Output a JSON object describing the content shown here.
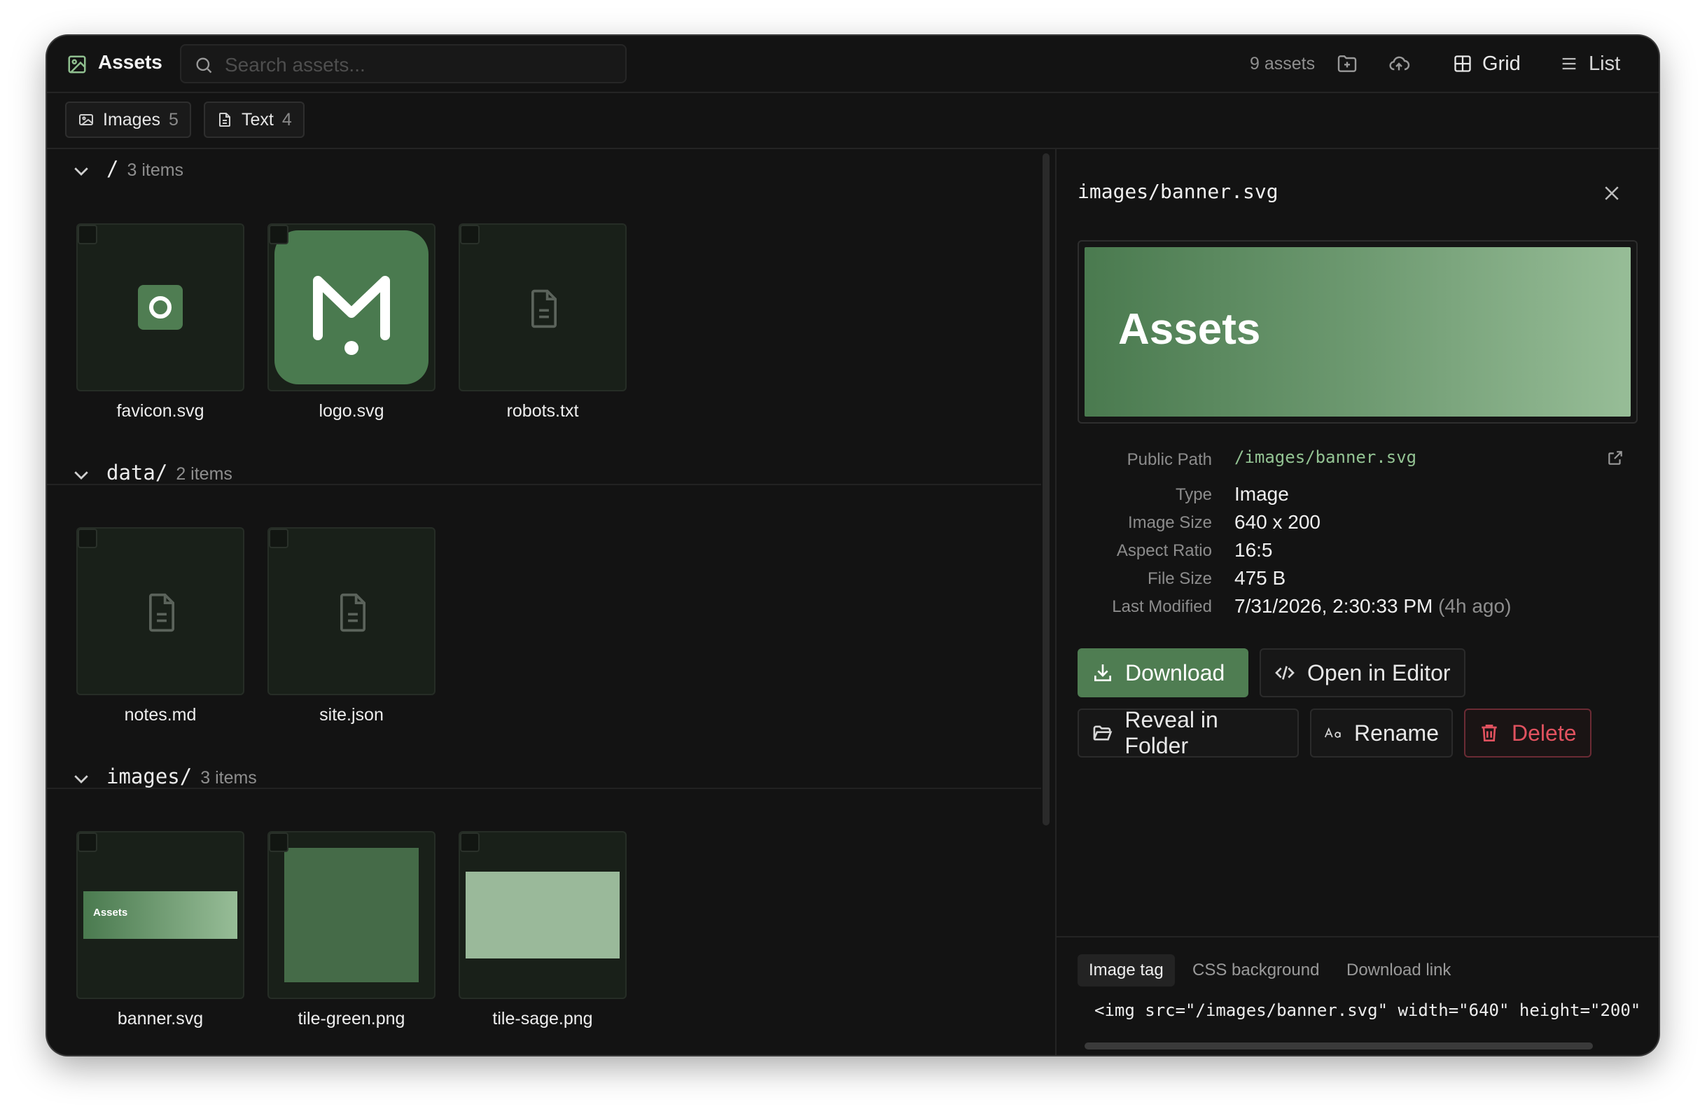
{
  "app": {
    "title": "Assets",
    "asset_count": "9 assets"
  },
  "search": {
    "placeholder": "Search assets..."
  },
  "view": {
    "grid_label": "Grid",
    "list_label": "List",
    "active": "grid"
  },
  "filters": [
    {
      "label": "Images",
      "count": "5"
    },
    {
      "label": "Text",
      "count": "4"
    }
  ],
  "sections": [
    {
      "name": "/",
      "count": "3 items",
      "files": [
        {
          "name": "favicon.svg",
          "preview": "favicon"
        },
        {
          "name": "logo.svg",
          "preview": "logo"
        },
        {
          "name": "robots.txt",
          "preview": "file-icon"
        }
      ]
    },
    {
      "name": "data/",
      "count": "2 items",
      "files": [
        {
          "name": "notes.md",
          "preview": "file-icon"
        },
        {
          "name": "site.json",
          "preview": "file-icon"
        }
      ]
    },
    {
      "name": "images/",
      "count": "3 items",
      "files": [
        {
          "name": "banner.svg",
          "preview": "banner",
          "preview_text": "Assets"
        },
        {
          "name": "tile-green.png",
          "preview": "tile-green"
        },
        {
          "name": "tile-sage.png",
          "preview": "tile-sage"
        }
      ]
    }
  ],
  "details": {
    "title": "images/banner.svg",
    "preview_text": "Assets",
    "fields": {
      "public_path": {
        "label": "Public Path",
        "value": "/images/banner.svg"
      },
      "type": {
        "label": "Type",
        "value": "Image"
      },
      "image_size": {
        "label": "Image Size",
        "value": "640 x 200"
      },
      "aspect_ratio": {
        "label": "Aspect Ratio",
        "value": "16:5"
      },
      "file_size": {
        "label": "File Size",
        "value": "475 B"
      },
      "last_modified": {
        "label": "Last Modified",
        "value": "7/31/2026, 2:30:33 PM",
        "relative": "(4h ago)"
      }
    },
    "actions": {
      "download": "Download",
      "open_editor": "Open in Editor",
      "reveal": "Reveal in Folder",
      "rename": "Rename",
      "delete": "Delete"
    },
    "snippet": {
      "tabs": [
        "Image tag",
        "CSS background",
        "Download link"
      ],
      "active_tab": "Image tag",
      "code": "<img src=\"/images/banner.svg\" width=\"640\" height=\"200\""
    }
  },
  "colors": {
    "accent": "#4f7d52",
    "accent_light": "#93c393",
    "sage": "#9ab99a",
    "danger": "#e0525f",
    "background": "#131313"
  }
}
